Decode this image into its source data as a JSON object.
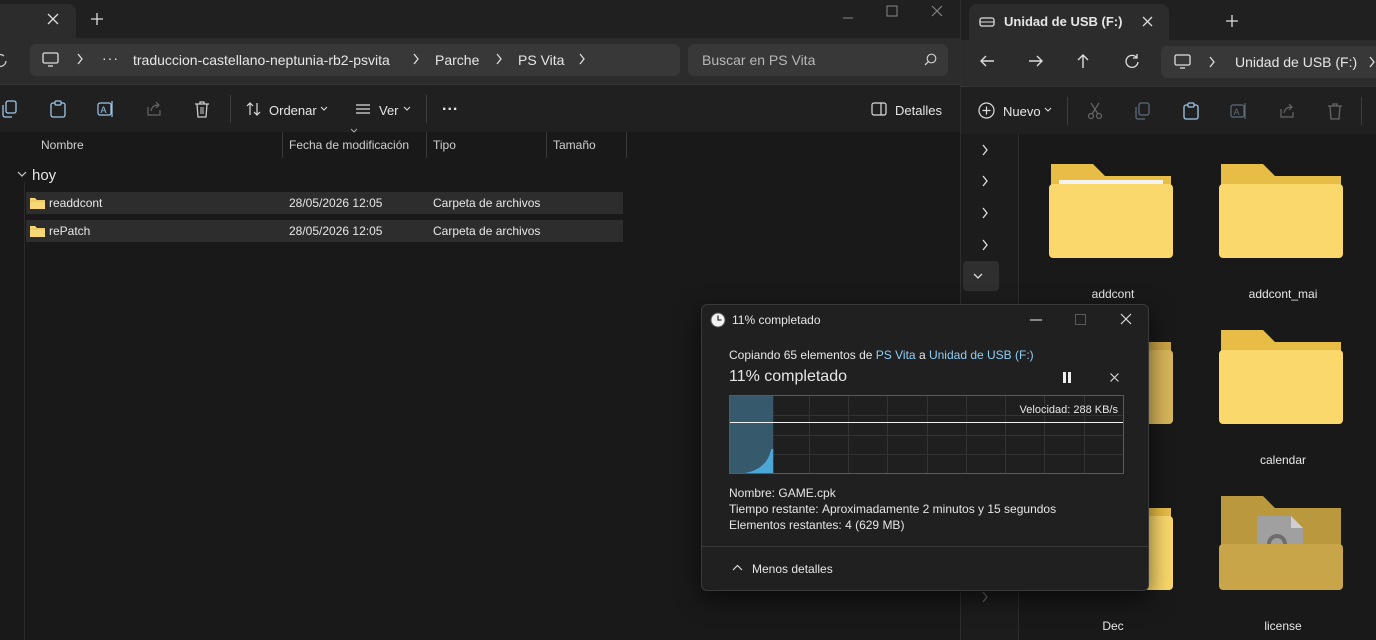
{
  "left_window": {
    "breadcrumb": [
      "traduccion-castellano-neptunia-rb2-psvita",
      "Parche",
      "PS Vita"
    ],
    "search_placeholder": "Buscar en PS Vita",
    "toolbar": {
      "sort_label": "Ordenar",
      "view_label": "Ver",
      "more_label": "...",
      "details_label": "Detalles"
    },
    "columns": [
      "Nombre",
      "Fecha de modificación",
      "Tipo",
      "Tamaño"
    ],
    "group_label": "hoy",
    "rows": [
      {
        "name": "readdcont",
        "date": "28/05/2026 12:05",
        "type": "Carpeta de archivos"
      },
      {
        "name": "rePatch",
        "date": "28/05/2026 12:05",
        "type": "Carpeta de archivos"
      }
    ]
  },
  "right_window": {
    "tab_title": "Unidad de USB (F:)",
    "address": "Unidad de USB (F:)",
    "new_label": "Nuevo",
    "folders": [
      "addcont",
      "addcont_mai",
      "calendar",
      "Dec",
      "license"
    ]
  },
  "copy_dialog": {
    "title": "11% completado",
    "progress_percent": 11,
    "line_prefix": "Copiando 65 elementos de",
    "source": "PS Vita",
    "connector": "a",
    "destination": "Unidad de USB (F:)",
    "heading": "11% completado",
    "speed": "Velocidad: 288 KB/s",
    "name_label": "Nombre:",
    "name_value": "GAME.cpk",
    "time_label": "Tiempo restante:",
    "time_value": "Aproximadamente 2 minutos y 15 segundos",
    "items_label": "Elementos restantes:",
    "items_value": "4 (629 MB)",
    "less_details": "Menos detalles"
  },
  "colors": {
    "accent_link": "#8fcdf5",
    "folder": "#f8d777",
    "graph_fill": "#4aa7d6"
  }
}
